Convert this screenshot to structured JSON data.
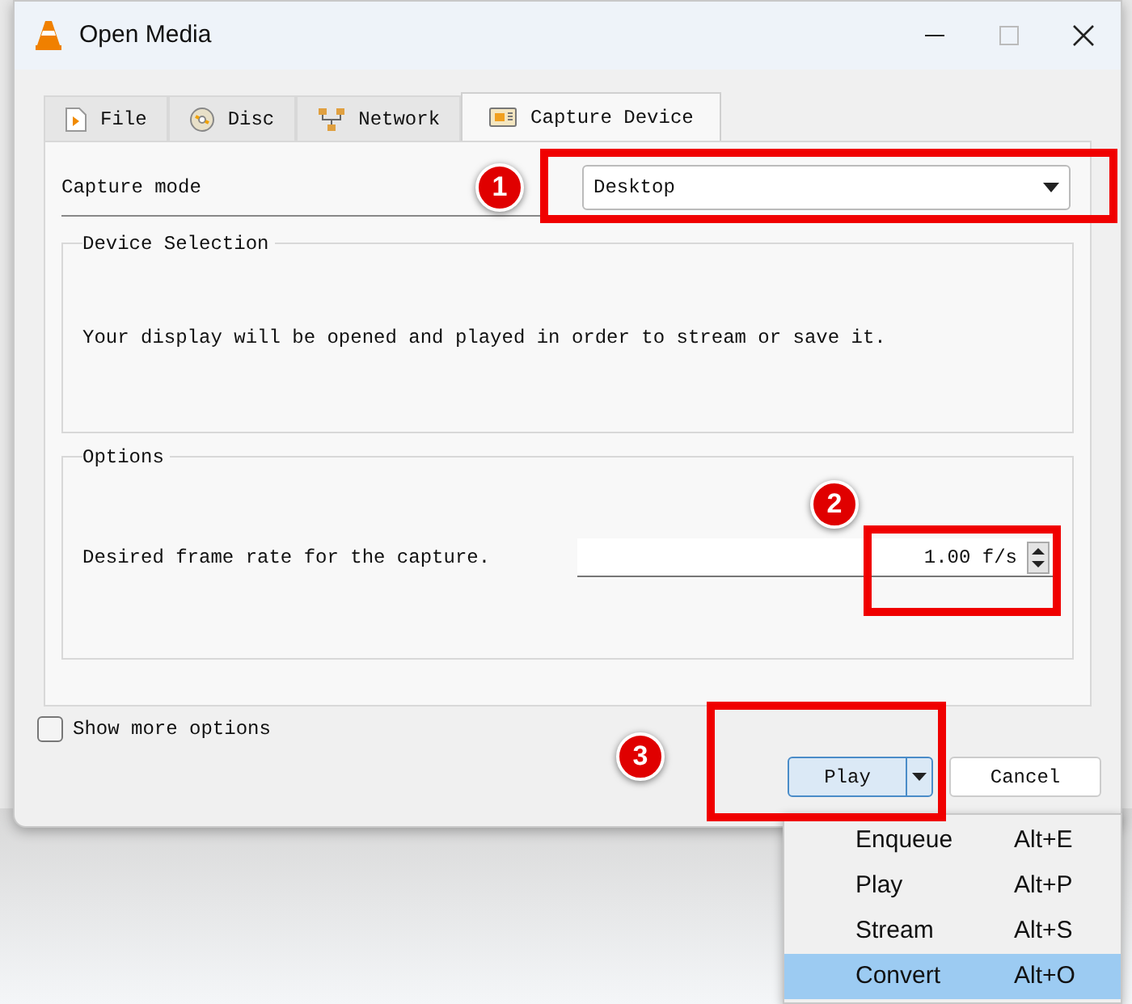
{
  "window": {
    "title": "Open Media"
  },
  "tabs": [
    {
      "label": "File",
      "selected": false
    },
    {
      "label": "Disc",
      "selected": false
    },
    {
      "label": "Network",
      "selected": false
    },
    {
      "label": "Capture Device",
      "selected": true
    }
  ],
  "capture_mode": {
    "label": "Capture mode",
    "value": "Desktop"
  },
  "device_selection": {
    "title": "Device Selection",
    "text": "Your display will be opened and played in order to stream or save it."
  },
  "options": {
    "title": "Options",
    "frame_rate_label": "Desired frame rate for the capture.",
    "frame_rate": "1.00 f/s"
  },
  "show_more_options": {
    "label": "Show more options",
    "checked": false
  },
  "buttons": {
    "play": "Play",
    "cancel": "Cancel"
  },
  "play_menu": [
    {
      "label": "Enqueue",
      "shortcut": "Alt+E",
      "selected": false
    },
    {
      "label": "Play",
      "shortcut": "Alt+P",
      "selected": false
    },
    {
      "label": "Stream",
      "shortcut": "Alt+S",
      "selected": false
    },
    {
      "label": "Convert",
      "shortcut": "Alt+O",
      "selected": true
    }
  ],
  "annotations": [
    "1",
    "2",
    "3"
  ]
}
